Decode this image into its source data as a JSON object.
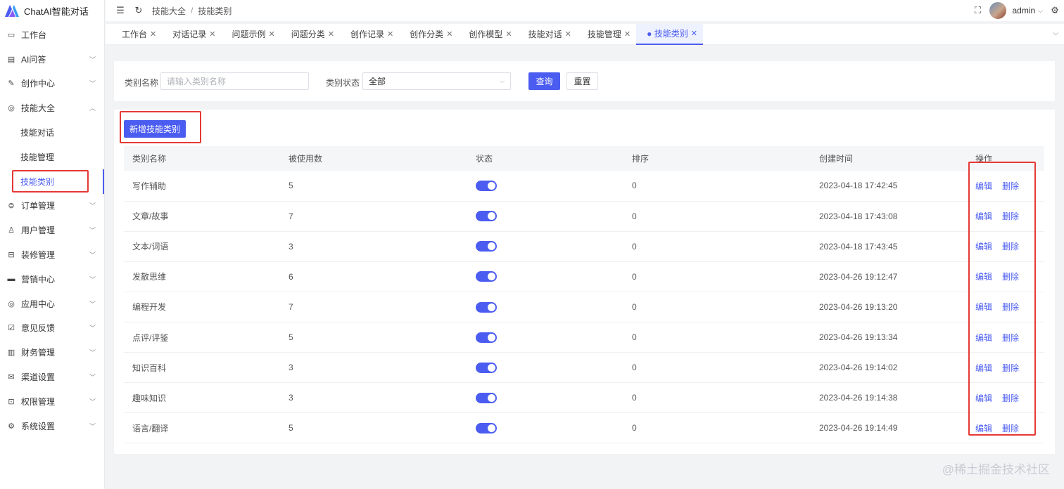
{
  "app": {
    "title": "ChatAI智能对话"
  },
  "sidebar": {
    "items": [
      {
        "label": "工作台",
        "icon": "monitor-icon",
        "glyph": "▭"
      },
      {
        "label": "AI问答",
        "icon": "chat-icon",
        "glyph": "▤"
      },
      {
        "label": "创作中心",
        "icon": "pen-icon",
        "glyph": "✎"
      },
      {
        "label": "技能大全",
        "icon": "skill-icon",
        "glyph": "◎"
      },
      {
        "label": "订单管理",
        "icon": "order-icon",
        "glyph": "⊜"
      },
      {
        "label": "用户管理",
        "icon": "user-icon",
        "glyph": "♙"
      },
      {
        "label": "装修管理",
        "icon": "decor-icon",
        "glyph": "⊟"
      },
      {
        "label": "营销中心",
        "icon": "marketing-icon",
        "glyph": "▬"
      },
      {
        "label": "应用中心",
        "icon": "app-icon",
        "glyph": "◎"
      },
      {
        "label": "意见反馈",
        "icon": "feedback-icon",
        "glyph": "☑"
      },
      {
        "label": "财务管理",
        "icon": "finance-icon",
        "glyph": "▥"
      },
      {
        "label": "渠道设置",
        "icon": "channel-icon",
        "glyph": "✉"
      },
      {
        "label": "权限管理",
        "icon": "lock-icon",
        "glyph": "⊡"
      },
      {
        "label": "系统设置",
        "icon": "settings-icon",
        "glyph": "⚙"
      }
    ],
    "sub_items": [
      "技能对话",
      "技能管理",
      "技能类别"
    ]
  },
  "header": {
    "breadcrumb": [
      "技能大全",
      "技能类别"
    ],
    "user": "admin"
  },
  "tabs": [
    "工作台",
    "对话记录",
    "问题示例",
    "问题分类",
    "创作记录",
    "创作分类",
    "创作模型",
    "技能对话",
    "技能管理",
    "● 技能类别"
  ],
  "filter": {
    "name_label": "类别名称",
    "name_placeholder": "请输入类别名称",
    "status_label": "类别状态",
    "status_value": "全部",
    "query_label": "查询",
    "reset_label": "重置"
  },
  "table": {
    "add_label": "新增技能类别",
    "columns": [
      "类别名称",
      "被使用数",
      "状态",
      "排序",
      "创建时间",
      "操作"
    ],
    "edit_label": "编辑",
    "delete_label": "删除",
    "rows": [
      {
        "name": "写作辅助",
        "used": "5",
        "enabled": true,
        "sort": "0",
        "created": "2023-04-18 17:42:45"
      },
      {
        "name": "文章/故事",
        "used": "7",
        "enabled": true,
        "sort": "0",
        "created": "2023-04-18 17:43:08"
      },
      {
        "name": "文本/词语",
        "used": "3",
        "enabled": true,
        "sort": "0",
        "created": "2023-04-18 17:43:45"
      },
      {
        "name": "发散思维",
        "used": "6",
        "enabled": true,
        "sort": "0",
        "created": "2023-04-26 19:12:47"
      },
      {
        "name": "编程开发",
        "used": "7",
        "enabled": true,
        "sort": "0",
        "created": "2023-04-26 19:13:20"
      },
      {
        "name": "点评/评鉴",
        "used": "5",
        "enabled": true,
        "sort": "0",
        "created": "2023-04-26 19:13:34"
      },
      {
        "name": "知识百科",
        "used": "3",
        "enabled": true,
        "sort": "0",
        "created": "2023-04-26 19:14:02"
      },
      {
        "name": "趣味知识",
        "used": "3",
        "enabled": true,
        "sort": "0",
        "created": "2023-04-26 19:14:38"
      },
      {
        "name": "语言/翻译",
        "used": "5",
        "enabled": true,
        "sort": "0",
        "created": "2023-04-26 19:14:49"
      }
    ]
  },
  "colors": {
    "accent": "#4b5cf0",
    "highlight": "#e53935"
  },
  "watermark": "@稀土掘金技术社区"
}
